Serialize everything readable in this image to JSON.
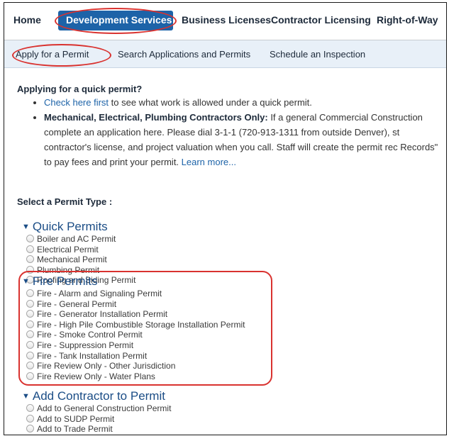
{
  "topnav": {
    "items": [
      "Home",
      "Development Services",
      "Business Licenses",
      "Contractor Licensing",
      "Right-of-Way"
    ]
  },
  "subnav": {
    "items": [
      "Apply for a Permit",
      "Search Applications and Permits",
      "Schedule an Inspection"
    ]
  },
  "intro": {
    "title": "Applying for a quick permit?",
    "bullet1_link": "Check here first",
    "bullet1_text": " to see what work is allowed under a quick permit.",
    "bullet2_bold": "Mechanical, Electrical, Plumbing Contractors Only:",
    "bullet2_text": " If a general Commercial Construction complete an application here. Please dial 3-1-1 (720-913-1311 from outside Denver), st contractor's license, and project valuation when you call. Staff will create the permit rec Records\" to pay fees and print your permit. ",
    "bullet2_link": "Learn more..."
  },
  "select_label": "Select a Permit Type :",
  "groups": [
    {
      "title": "Quick Permits",
      "options": [
        "Boiler and AC Permit",
        "Electrical Permit",
        "Mechanical Permit",
        "Plumbing Permit",
        "Roofing and Siding Permit"
      ]
    },
    {
      "title": "Fire Permits",
      "options": [
        "Fire - Alarm and Signaling Permit",
        "Fire - General Permit",
        "Fire - Generator Installation Permit",
        "Fire - High Pile Combustible Storage Installation Permit",
        "Fire - Smoke Control Permit",
        "Fire - Suppression Permit",
        "Fire - Tank Installation Permit",
        "Fire Review Only - Other Jurisdiction",
        "Fire Review Only - Water Plans"
      ]
    },
    {
      "title": "Add Contractor to Permit",
      "options": [
        "Add to General Construction Permit",
        "Add to SUDP Permit",
        "Add to Trade Permit"
      ]
    }
  ]
}
